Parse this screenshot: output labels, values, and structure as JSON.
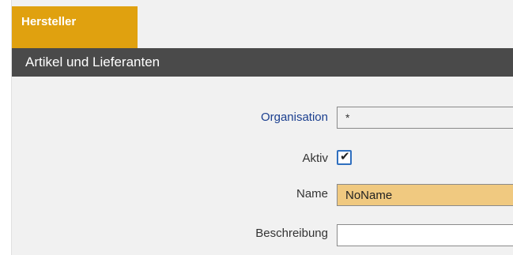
{
  "tab": {
    "label": "Hersteller"
  },
  "section": {
    "title": "Artikel und Lieferanten"
  },
  "form": {
    "organisation": {
      "label": "Organisation",
      "value": "*"
    },
    "aktiv": {
      "label": "Aktiv",
      "checked": true,
      "check_glyph": "✔"
    },
    "name": {
      "label": "Name",
      "value": "NoName"
    },
    "beschreibung": {
      "label": "Beschreibung",
      "value": ""
    }
  },
  "colors": {
    "tab": "#e0a10f",
    "section_bar": "#4a4a4a",
    "name_field": "#f0c980",
    "organisation_label": "#1b3f8f",
    "checkbox_border": "#2f6fbf"
  }
}
